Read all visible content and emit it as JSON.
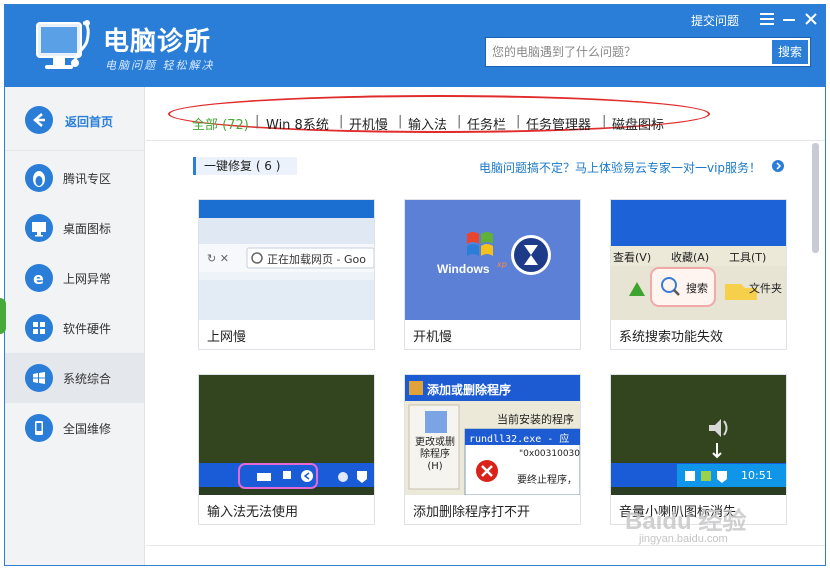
{
  "header": {
    "app_title": "电脑诊所",
    "app_slogan": "电脑问题 轻松解决",
    "feedback_link": "提交问题",
    "menu_icon": "menu-icon",
    "minimize_icon": "minimize-icon",
    "close_icon": "close-icon",
    "search": {
      "placeholder": "您的电脑遇到了什么问题？",
      "value": "",
      "button_label": "搜索"
    }
  },
  "sidebar": {
    "back_label": "返回首页",
    "items": [
      {
        "label": "腾讯专区",
        "icon": "penguin-icon"
      },
      {
        "label": "桌面图标",
        "icon": "monitor-icon"
      },
      {
        "label": "上网异常",
        "icon": "ie-icon"
      },
      {
        "label": "软件硬件",
        "icon": "puzzle-icon"
      },
      {
        "label": "系统综合",
        "icon": "windows-icon",
        "active": true
      },
      {
        "label": "全国维修",
        "icon": "phone-icon"
      }
    ]
  },
  "tabs": [
    {
      "label": "全部 (72)",
      "active": true
    },
    {
      "label": "Win 8系统"
    },
    {
      "label": "开机慢"
    },
    {
      "label": "输入法"
    },
    {
      "label": "任务栏"
    },
    {
      "label": "任务管理器"
    },
    {
      "label": "磁盘图标"
    }
  ],
  "tab_separator": "|",
  "section": {
    "title": "一键修复 ( 6 )",
    "promo_text": "电脑问题搞不定？马上体验易云专家一对一vip服务！"
  },
  "cards": [
    {
      "label": "上网慢",
      "thumb": {
        "loading_text": "正在加载网页 - Goo"
      }
    },
    {
      "label": "开机慢",
      "thumb": {
        "brand": "Windows",
        "edition": "xp"
      }
    },
    {
      "label": "系统搜索功能失效",
      "thumb": {
        "menu": [
          "查看(V)",
          "收藏(A)",
          "工具(T)"
        ],
        "search_label": "搜索",
        "folder_label": "文件夹"
      }
    },
    {
      "label": "输入法无法使用",
      "thumb": {}
    },
    {
      "label": "添加删除程序打不开",
      "thumb": {
        "window_title": "添加或删除程序",
        "installed_text": "当前安装的程序",
        "change_label": "更改或删除程序(H)",
        "error_title": "rundll32.exe - 应",
        "error_code": "\"0x00310030\"",
        "error_text": "要终止程序，"
      }
    },
    {
      "label": "音量小喇叭图标消失",
      "thumb": {
        "clock": "10:51"
      }
    }
  ],
  "watermark": {
    "text": "Baidu 经验",
    "sub": "jingyan.baidu.com"
  },
  "colors": {
    "brand_blue": "#2a7ed8",
    "active_tab_green": "#47a93a",
    "highlight_red": "#e12c2c",
    "link_blue": "#1a78c8"
  }
}
